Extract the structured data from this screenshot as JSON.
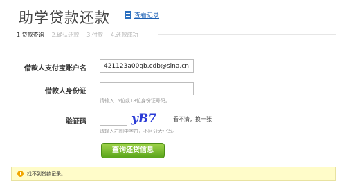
{
  "header": {
    "title": "助学贷款还款",
    "records_link": "查看记录"
  },
  "steps": [
    {
      "label": "1.贷款查询",
      "active": true
    },
    {
      "label": "2.确认还款",
      "active": false
    },
    {
      "label": "3.付款",
      "active": false
    },
    {
      "label": "4.还款成功",
      "active": false
    }
  ],
  "form": {
    "account": {
      "label": "借款人支付宝账户名",
      "value": "421123a00qb.cdb@sina.cn"
    },
    "id_card": {
      "label": "借款人身份证",
      "value": "",
      "hint": "请输入15位或18位身份证号码。"
    },
    "captcha": {
      "label": "验证码",
      "value": "",
      "image_text": "yB7",
      "refresh": "看不清，换一张",
      "hint": "请输入右图中字符，不区分大小写。"
    },
    "submit": "查询还贷信息"
  },
  "notice": {
    "text": "找不到贷款记录。",
    "icon": "warning-icon",
    "background": "#fffcc9"
  },
  "colors": {
    "link": "#1a5fb4",
    "button": "#6cb52a"
  }
}
